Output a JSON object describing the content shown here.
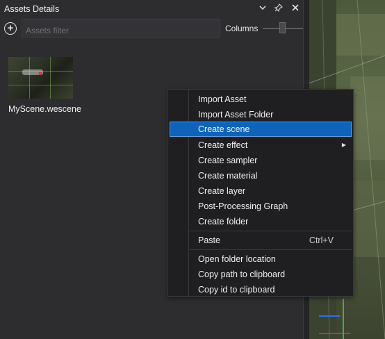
{
  "panel": {
    "title": "Assets Details",
    "filter_placeholder": "Assets filter",
    "columns_label": "Columns"
  },
  "asset": {
    "name": "MyScene.wescene"
  },
  "menu": {
    "items": [
      {
        "label": "Import Asset"
      },
      {
        "label": "Import Asset Folder"
      },
      {
        "label": "Create scene",
        "highlighted": true
      },
      {
        "label": "Create effect",
        "submenu": true
      },
      {
        "label": "Create sampler"
      },
      {
        "label": "Create material"
      },
      {
        "label": "Create layer"
      },
      {
        "label": "Post-Processing Graph"
      },
      {
        "label": "Create folder"
      },
      {
        "label": "Paste",
        "shortcut": "Ctrl+V"
      },
      {
        "label": "Open folder location"
      },
      {
        "label": "Copy path to clipboard"
      },
      {
        "label": "Copy id to clipboard"
      }
    ]
  },
  "colors": {
    "highlight": "#0f64b9",
    "panel_bg": "#2d2d30",
    "menu_bg": "#1f1f21"
  }
}
